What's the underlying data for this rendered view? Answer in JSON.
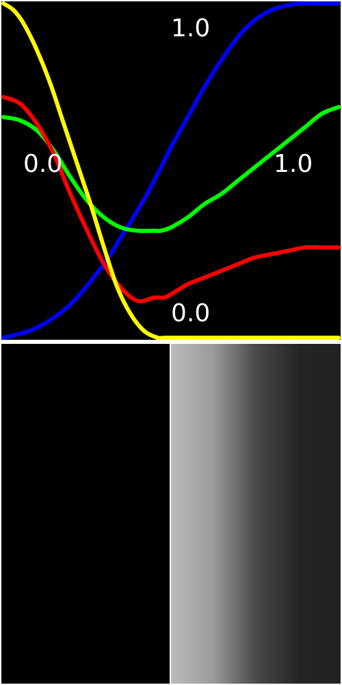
{
  "chart_data": {
    "type": "line",
    "title": "",
    "xlabel": "",
    "ylabel": "",
    "xlim": [
      0.0,
      1.0
    ],
    "ylim": [
      0.0,
      1.0
    ],
    "grid": false,
    "legend": "none",
    "background": "#000000",
    "tick_labels": {
      "x_min": "0.0",
      "x_max": "1.0",
      "y_min": "0.0",
      "y_max": "1.0"
    },
    "series": [
      {
        "color": "#0000ff",
        "x": [
          0.0,
          0.1,
          0.2,
          0.3,
          0.35,
          0.4,
          0.45,
          0.5,
          0.55,
          0.6,
          0.65,
          0.7,
          0.75,
          0.8,
          0.85,
          0.9,
          0.95,
          1.0
        ],
        "y": [
          0.0,
          0.03,
          0.1,
          0.22,
          0.3,
          0.38,
          0.47,
          0.57,
          0.66,
          0.75,
          0.83,
          0.9,
          0.95,
          0.98,
          0.995,
          1.0,
          1.0,
          1.0
        ]
      },
      {
        "color": "#00ff00",
        "x": [
          0.0,
          0.05,
          0.1,
          0.15,
          0.2,
          0.25,
          0.3,
          0.35,
          0.4,
          0.45,
          0.47,
          0.5,
          0.55,
          0.6,
          0.65,
          0.7,
          0.75,
          0.8,
          0.85,
          0.9,
          0.95,
          1.0
        ],
        "y": [
          0.66,
          0.65,
          0.62,
          0.56,
          0.48,
          0.41,
          0.36,
          0.33,
          0.32,
          0.32,
          0.32,
          0.33,
          0.36,
          0.4,
          0.43,
          0.47,
          0.51,
          0.55,
          0.59,
          0.63,
          0.67,
          0.69
        ]
      },
      {
        "color": "#ff0000",
        "x": [
          0.0,
          0.05,
          0.1,
          0.15,
          0.2,
          0.25,
          0.3,
          0.35,
          0.4,
          0.45,
          0.48,
          0.5,
          0.55,
          0.6,
          0.65,
          0.7,
          0.75,
          0.8,
          0.85,
          0.9,
          0.95,
          1.0
        ],
        "y": [
          0.72,
          0.7,
          0.64,
          0.55,
          0.43,
          0.32,
          0.22,
          0.15,
          0.11,
          0.12,
          0.12,
          0.13,
          0.16,
          0.18,
          0.2,
          0.22,
          0.24,
          0.25,
          0.26,
          0.27,
          0.27,
          0.27
        ]
      },
      {
        "color": "#ffff00",
        "x": [
          0.0,
          0.03,
          0.06,
          0.1,
          0.14,
          0.18,
          0.22,
          0.26,
          0.3,
          0.34,
          0.38,
          0.42,
          0.46,
          0.48,
          0.5,
          0.6,
          0.7,
          0.8,
          0.9,
          1.0
        ],
        "y": [
          1.0,
          0.98,
          0.94,
          0.86,
          0.76,
          0.64,
          0.52,
          0.4,
          0.27,
          0.15,
          0.07,
          0.02,
          0.0,
          0.0,
          0.0,
          0.0,
          0.0,
          0.0,
          0.0,
          0.0
        ]
      }
    ]
  },
  "swatches": {
    "left_color": "#000000",
    "right_gradient": [
      "#bbbbbb",
      "#9a9a9a",
      "#4a4a4a",
      "#242424",
      "#222222"
    ]
  }
}
